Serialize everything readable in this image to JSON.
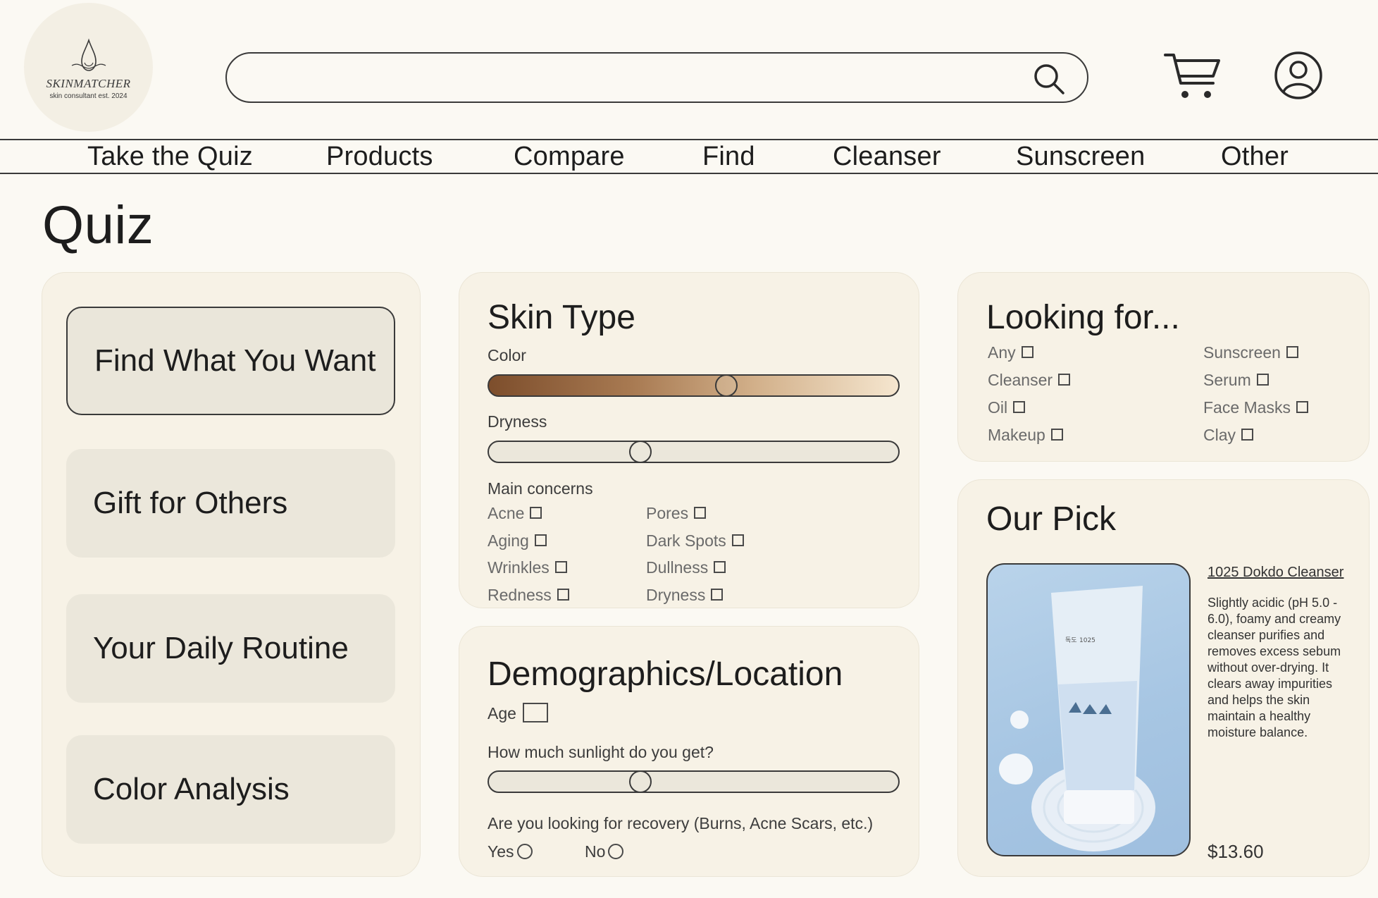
{
  "brand": {
    "name": "SKINMATCHER",
    "tagline": "skin consultant est. 2024"
  },
  "search": {
    "value": "",
    "placeholder": ""
  },
  "nav": {
    "items": [
      "Take the Quiz",
      "Products",
      "Compare",
      "Find",
      "Cleanser",
      "Sunscreen",
      "Other"
    ]
  },
  "page": {
    "title": "Quiz"
  },
  "menu": {
    "items": [
      "Find What You Want",
      "Gift for Others",
      "Your Daily Routine",
      "Color Analysis"
    ],
    "active_index": 0
  },
  "skin_type": {
    "title": "Skin Type",
    "color_label": "Color",
    "color_value": 0.58,
    "dryness_label": "Dryness",
    "dryness_value": 0.37,
    "concerns_label": "Main concerns",
    "concerns_left": [
      "Acne",
      "Aging",
      "Wrinkles",
      "Redness"
    ],
    "concerns_right": [
      "Pores",
      "Dark Spots",
      "Dullness",
      "Dryness"
    ]
  },
  "demographics": {
    "title": "Demographics/Location",
    "age_label": "Age",
    "age_value": "",
    "sunlight_label": "How much sunlight do you get?",
    "sunlight_value": 0.37,
    "recovery_label": "Are you looking for recovery (Burns, Acne Scars, etc.)",
    "yes_label": "Yes",
    "no_label": "No"
  },
  "looking_for": {
    "title": "Looking for...",
    "left": [
      "Any",
      "Cleanser",
      "Oil",
      "Makeup"
    ],
    "right": [
      "Sunscreen",
      "Serum",
      "Face Masks",
      "Clay"
    ]
  },
  "our_pick": {
    "title": "Our Pick",
    "product_name": "1025 Dokdo Cleanser",
    "description": "Slightly acidic (pH 5.0 - 6.0), foamy and creamy cleanser purifies and removes excess sebum without over-drying. It clears away impurities and helps the skin maintain a healthy moisture balance.",
    "price": "$13.60"
  },
  "colors": {
    "background": "#fbf9f3",
    "card": "#f7f2e6",
    "button": "#ebe7db",
    "outline": "#3a3a3a",
    "skin_dark": "#7d4e2c",
    "skin_light": "#f5e6cf",
    "product_bg": "#a7c6e3"
  },
  "icons": [
    "search-icon",
    "cart-icon",
    "user-icon",
    "checkbox",
    "radio"
  ]
}
